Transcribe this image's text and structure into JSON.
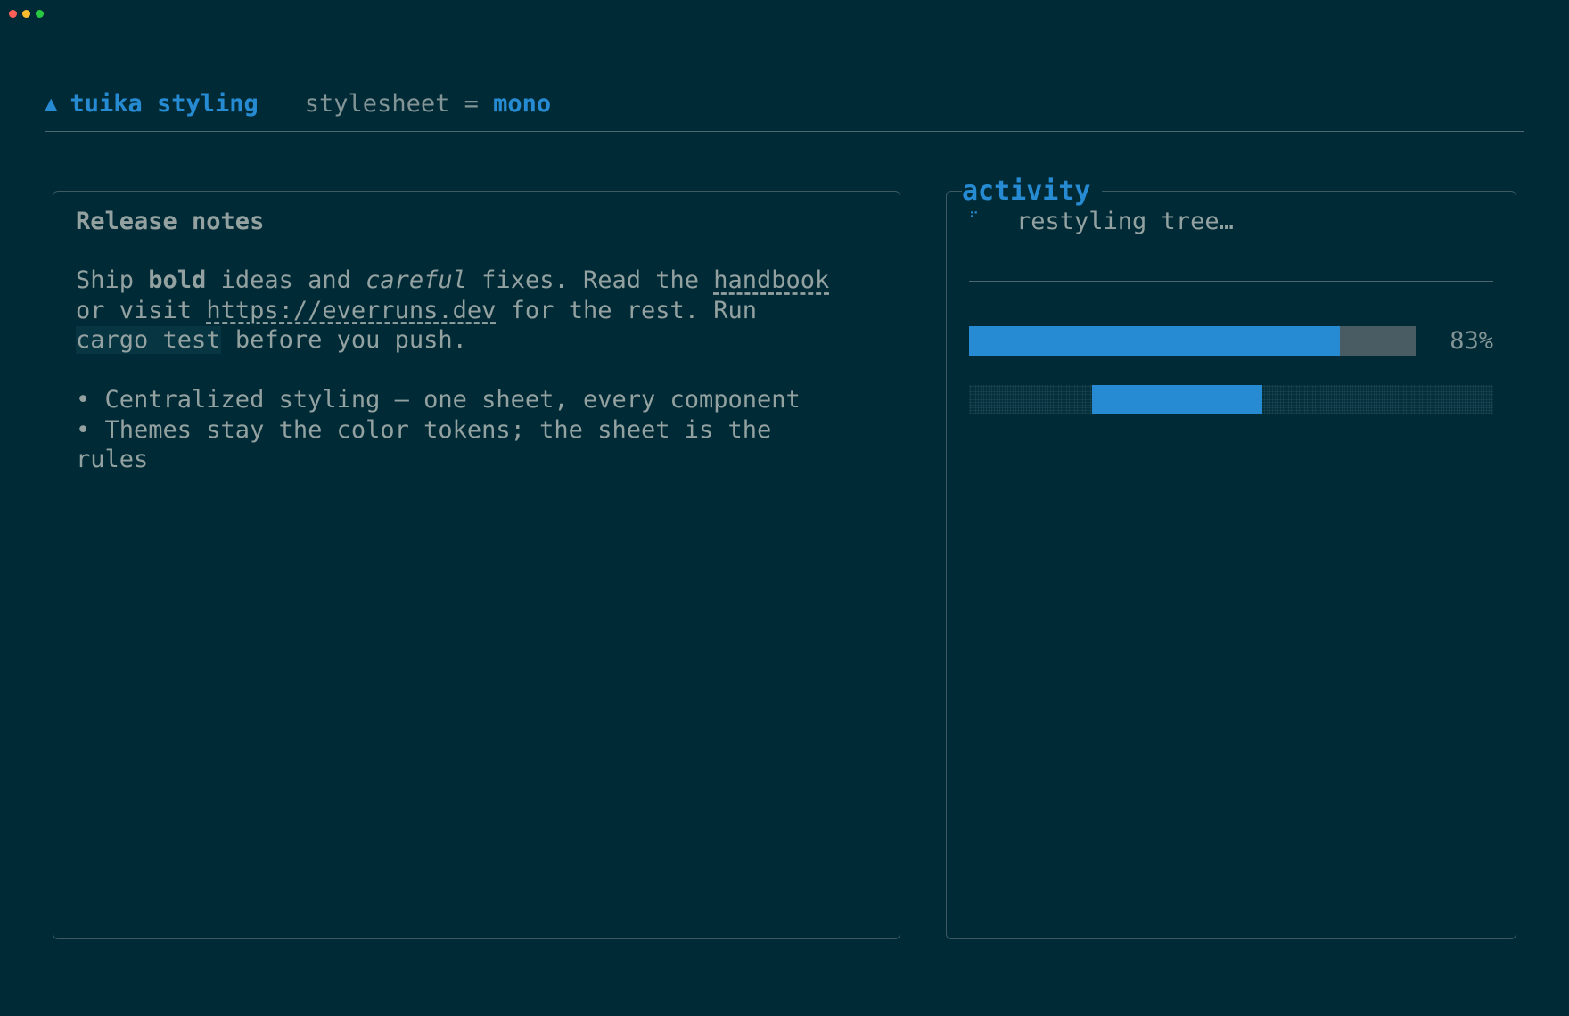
{
  "window": {
    "controls": [
      "close",
      "minimize",
      "zoom"
    ],
    "control_colors": [
      "#ff5f57",
      "#febc2e",
      "#28c840"
    ]
  },
  "header": {
    "icon": "triangle-up-icon",
    "icon_glyph": "▲",
    "title": "tuika styling",
    "setting_key": "stylesheet",
    "setting_op": "=",
    "setting_value": "mono"
  },
  "notes": {
    "title": "Release notes",
    "paragraph": {
      "t1": "Ship ",
      "bold": "bold",
      "t2": " ideas and ",
      "italic": "careful",
      "t3": " fixes. Read the ",
      "link1": "handbook",
      "t4": "or visit ",
      "link2": "https://everruns.dev",
      "t5": " for the rest. Run",
      "code": "cargo test",
      "t6": " before you push."
    },
    "bullets": [
      "• Centralized styling — one sheet, every component",
      "• Themes stay the color tokens; the sheet is the",
      "rules"
    ]
  },
  "activity": {
    "title": "activity",
    "spinner_icon": "spinner-icon",
    "spinner_glyph": "⠋",
    "status": "restyling tree…",
    "progress": {
      "value": 0.83,
      "label": "83%"
    },
    "indeterminate": {
      "start": 0.235,
      "end": 0.56
    }
  },
  "colors": {
    "background": "#002b36",
    "accent": "#268bd2",
    "text": "#93a1a1",
    "muted": "#839496",
    "track": "#4a5c63",
    "code_bg": "#073642"
  }
}
